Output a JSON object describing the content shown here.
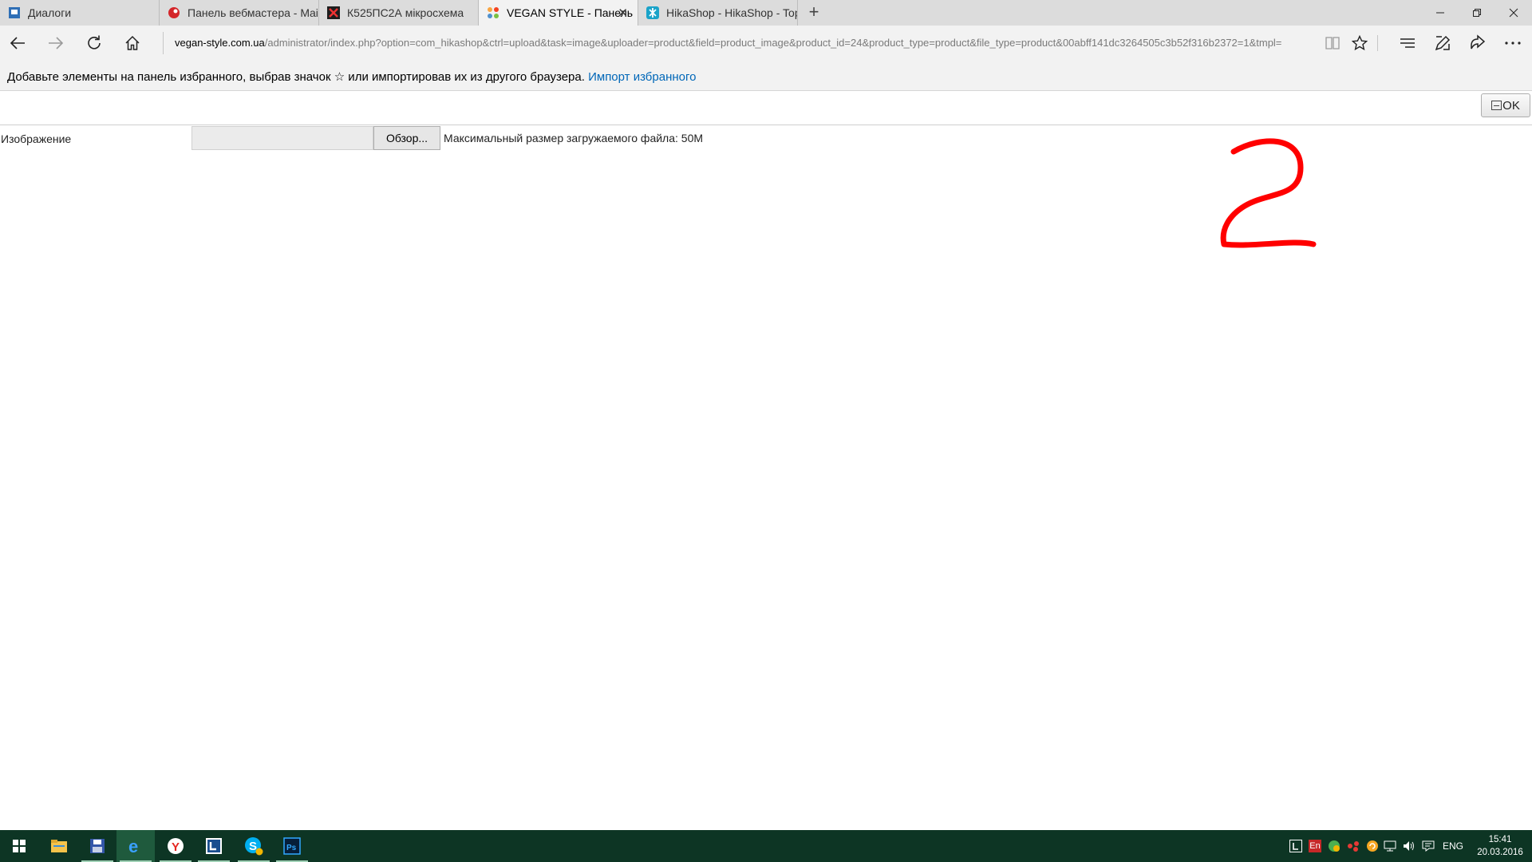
{
  "browser": {
    "tabs": [
      {
        "title": "Диалоги",
        "favicon": "dialogs-icon",
        "active": false
      },
      {
        "title": "Панель вебмастера - Main",
        "favicon": "yandex-webmaster-icon",
        "active": false
      },
      {
        "title": "К525ПС2А мікросхема",
        "favicon": "microchip-site-icon",
        "active": false
      },
      {
        "title": "VEGAN STYLE - Панель",
        "favicon": "joomla-icon",
        "active": true
      },
      {
        "title": "HikaShop - HikaShop - Topi",
        "favicon": "hikashop-icon",
        "active": false
      }
    ],
    "new_tab_symbol": "+",
    "close_tab_symbol": "✕",
    "address": {
      "host": "vegan-style.com.ua",
      "path": "/administrator/index.php?option=com_hikashop&ctrl=upload&task=image&uploader=product&field=product_image&product_id=24&product_type=product&file_type=product&00abff141dc3264505c3b52f316b2372=1&tmpl="
    },
    "favorites_hint": {
      "text": "Добавьте элементы на панель избранного, выбрав значок ☆ или импортировав их из другого браузера. ",
      "link": "Импорт избранного"
    }
  },
  "page": {
    "ok_label": "OK",
    "field_label": "Изображение",
    "browse_label": "Обзор...",
    "max_size_text": "Максимальный размер загружаемого файла: 50M",
    "annotation_color": "#ff0000"
  },
  "taskbar": {
    "apps": [
      "start-icon",
      "file-explorer-icon",
      "save-disk-icon",
      "edge-icon",
      "yandex-browser-icon",
      "lingvo-icon",
      "skype-icon",
      "photoshop-icon"
    ],
    "language": "ENG",
    "time": "15:41",
    "date": "20.03.2016",
    "background_color": "#0d3524"
  }
}
